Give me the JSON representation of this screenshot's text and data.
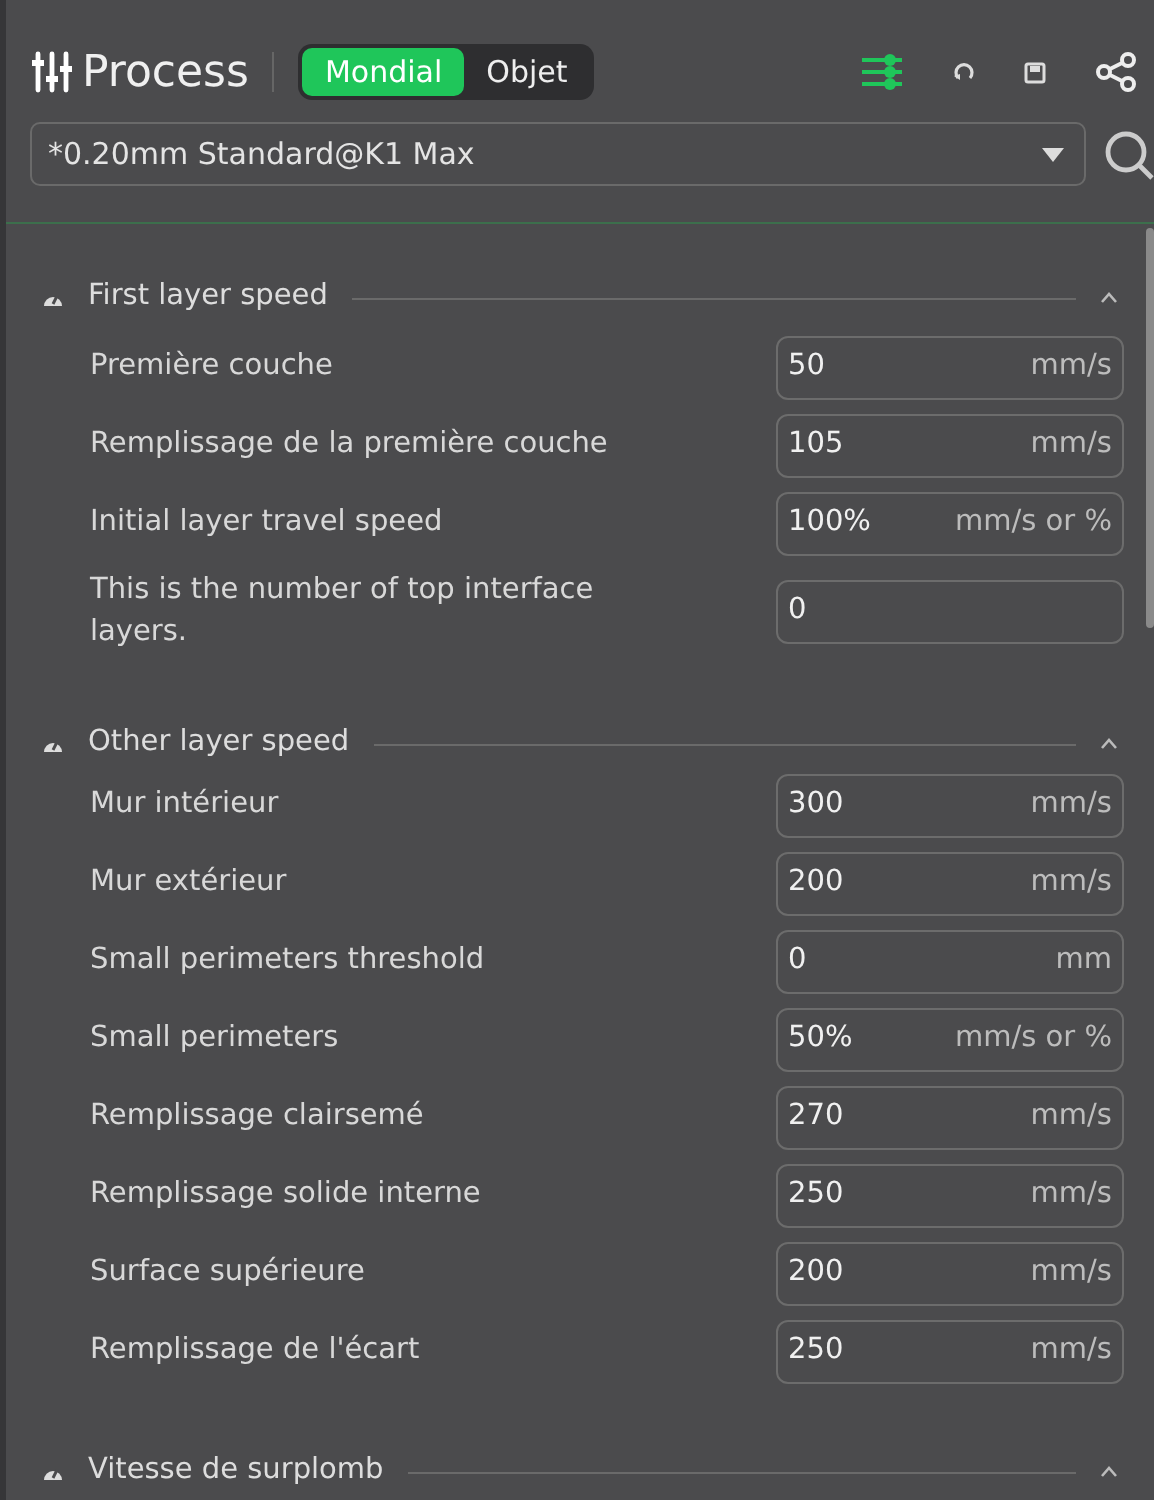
{
  "header": {
    "title": "Process",
    "tabs": [
      {
        "label": "Mondial",
        "selected": true
      },
      {
        "label": "Objet",
        "selected": false
      }
    ],
    "advanced_on": true
  },
  "preset": {
    "value": "*0.20mm Standard@K1 Max"
  },
  "sections": [
    {
      "title": "First layer speed",
      "expanded": true,
      "rows": [
        {
          "label": "Première couche",
          "value": "50",
          "unit": "mm/s"
        },
        {
          "label": "Remplissage de la première couche",
          "value": "105",
          "unit": "mm/s"
        },
        {
          "label": "Initial layer travel speed",
          "value": "100%",
          "unit": "mm/s or %"
        },
        {
          "label": "This is the number of top interface layers.",
          "value": "0"
        }
      ]
    },
    {
      "title": "Other layer speed",
      "expanded": true,
      "rows": [
        {
          "label": "Mur intérieur",
          "value": "300",
          "unit": "mm/s"
        },
        {
          "label": "Mur extérieur",
          "value": "200",
          "unit": "mm/s"
        },
        {
          "label": "Small perimeters threshold",
          "value": "0",
          "unit": "mm"
        },
        {
          "label": "Small perimeters",
          "value": "50%",
          "unit": "mm/s or %"
        },
        {
          "label": "Remplissage clairsemé",
          "value": "270",
          "unit": "mm/s"
        },
        {
          "label": "Remplissage solide interne",
          "value": "250",
          "unit": "mm/s"
        },
        {
          "label": "Surface supérieure",
          "value": "200",
          "unit": "mm/s"
        },
        {
          "label": "Remplissage de l'écart",
          "value": "250",
          "unit": "mm/s"
        }
      ]
    },
    {
      "title": "Vitesse de surplomb",
      "expanded": true
    }
  ]
}
